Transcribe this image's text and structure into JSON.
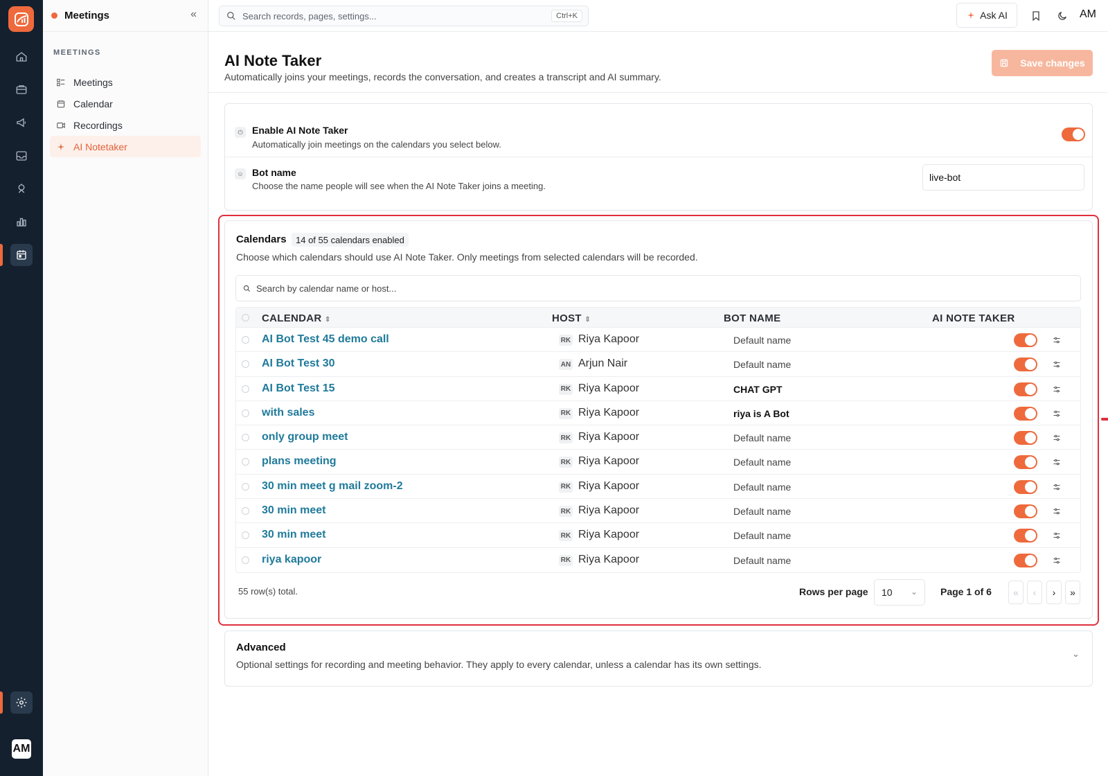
{
  "sidebar": {
    "title": "Meetings",
    "section": "MEETINGS",
    "items": [
      {
        "label": "Meetings",
        "icon": "list-icon"
      },
      {
        "label": "Calendar",
        "icon": "calendar-icon"
      },
      {
        "label": "Recordings",
        "icon": "video-icon"
      },
      {
        "label": "AI Notetaker",
        "icon": "sparkle-icon",
        "active": true
      }
    ]
  },
  "rail": {
    "avatar": "AM"
  },
  "topbar": {
    "search_placeholder": "Search records, pages, settings...",
    "search_shortcut": "Ctrl+K",
    "ask_ai": "Ask AI",
    "initials": "AM"
  },
  "page": {
    "title": "AI Note Taker",
    "subtitle": "Automatically joins your meetings, records the conversation, and creates a transcript and AI summary.",
    "save_label": "Save changes"
  },
  "settings": {
    "enable": {
      "title": "Enable AI Note Taker",
      "desc": "Automatically join meetings on the calendars you select below.",
      "on": true
    },
    "bot_name": {
      "title": "Bot name",
      "desc": "Choose the name people will see when the AI Note Taker joins a meeting.",
      "value": "live-bot"
    }
  },
  "calendars": {
    "title": "Calendars",
    "badge": "14 of 55 calendars enabled",
    "desc": "Choose which calendars should use AI Note Taker. Only meetings from selected calendars will be recorded.",
    "search_placeholder": "Search by calendar name or host...",
    "columns": {
      "calendar": "CALENDAR",
      "host": "HOST",
      "bot_name": "BOT NAME",
      "ai_note_taker": "AI NOTE TAKER"
    },
    "rows": [
      {
        "name": "AI Bot Test 45 demo call",
        "host_initials": "RK",
        "host": "Riya Kapoor",
        "bot": "Default name",
        "custom": false
      },
      {
        "name": "AI Bot Test 30",
        "host_initials": "AN",
        "host": "Arjun Nair",
        "bot": "Default name",
        "custom": false
      },
      {
        "name": "AI Bot Test 15",
        "host_initials": "RK",
        "host": "Riya Kapoor",
        "bot": "CHAT GPT",
        "custom": true
      },
      {
        "name": "with sales",
        "host_initials": "RK",
        "host": "Riya Kapoor",
        "bot": "riya is A Bot",
        "custom": true
      },
      {
        "name": "only group meet",
        "host_initials": "RK",
        "host": "Riya Kapoor",
        "bot": "Default name",
        "custom": false
      },
      {
        "name": "plans meeting",
        "host_initials": "RK",
        "host": "Riya Kapoor",
        "bot": "Default name",
        "custom": false
      },
      {
        "name": "30 min meet g mail zoom-2",
        "host_initials": "RK",
        "host": "Riya Kapoor",
        "bot": "Default name",
        "custom": false
      },
      {
        "name": "30 min meet",
        "host_initials": "RK",
        "host": "Riya Kapoor",
        "bot": "Default name",
        "custom": false
      },
      {
        "name": "30 min meet",
        "host_initials": "RK",
        "host": "Riya Kapoor",
        "bot": "Default name",
        "custom": false
      },
      {
        "name": "riya kapoor",
        "host_initials": "RK",
        "host": "Riya Kapoor",
        "bot": "Default name",
        "custom": false
      }
    ],
    "rows_total": "55 row(s) total.",
    "rows_per_page_label": "Rows per page",
    "rows_per_page": "10",
    "page_label": "Page 1 of 6",
    "pager": {
      "first": "«",
      "prev": "‹",
      "next": "›",
      "last": "»"
    }
  },
  "advanced": {
    "title": "Advanced",
    "desc": "Optional settings for recording and meeting behavior. They apply to every calendar, unless a calendar has its own settings."
  },
  "colors": {
    "accent": "#ee6a3d",
    "rail": "#15202e",
    "link": "#1f7a9a",
    "highlight": "#e0303d"
  }
}
